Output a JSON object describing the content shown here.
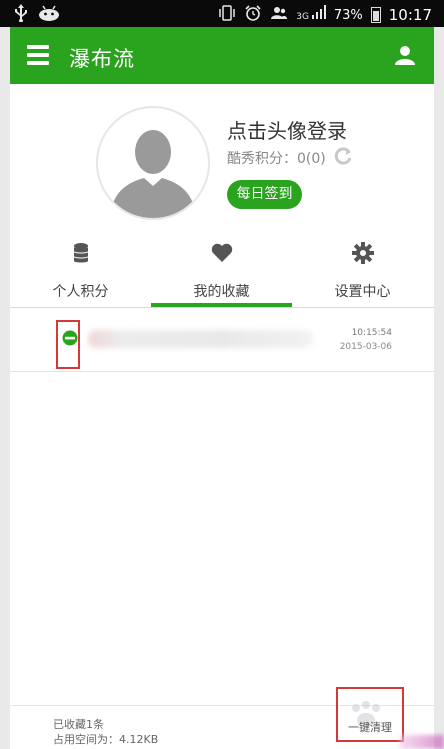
{
  "status_bar": {
    "left_icons": [
      "usb-icon",
      "android-icon"
    ],
    "right_icons": [
      "vibrate-icon",
      "alarm-icon",
      "contacts-icon"
    ],
    "network": "3G",
    "battery": "73%",
    "time": "10:17"
  },
  "app_bar": {
    "title": "瀑布流"
  },
  "profile": {
    "login_prompt": "点击头像登录",
    "points_text": "酷秀积分：0(0)",
    "checkin_label": "每日签到"
  },
  "tabs": [
    {
      "label": "个人积分",
      "icon": "database-icon"
    },
    {
      "label": "我的收藏",
      "icon": "heart-icon",
      "active": true
    },
    {
      "label": "设置中心",
      "icon": "gear-icon"
    }
  ],
  "favorites": [
    {
      "time": "10:15:54",
      "date": "2015-03-06"
    }
  ],
  "footer": {
    "count_text": "已收藏1条",
    "space_text": "占用空间为：4.12KB",
    "clean_label": "一键清理"
  },
  "colors": {
    "brand_green": "#2aa31f",
    "highlight_red": "#d23a3a"
  }
}
